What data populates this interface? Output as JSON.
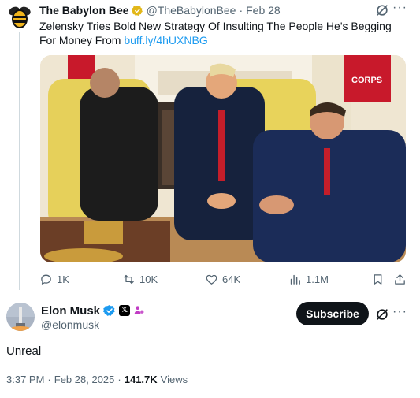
{
  "parent": {
    "author_name": "The Babylon Bee",
    "author_handle": "@TheBabylonBee",
    "separator": "·",
    "date": "Feb 28",
    "text": "Zelensky Tries Bold New Strategy Of Insulting The People He's Begging For Money From",
    "link_text": "buff.ly/4hUXNBG",
    "image_caption": ""
  },
  "actions": {
    "replies": "1K",
    "reposts": "10K",
    "likes": "64K",
    "views": "1.1M"
  },
  "tweet": {
    "author_name": "Elon Musk",
    "author_handle": "@elonmusk",
    "x_badge": "𝕏",
    "subscribe_label": "Subscribe",
    "text": "Unreal",
    "time": "3:37 PM",
    "date_sep": "·",
    "date": "Feb 28, 2025",
    "views_sep": "·",
    "views_count": "141.7K",
    "views_label": "Views"
  },
  "icons": {
    "parent_avatar": "bee-logo-icon",
    "gold_check": "gold-verified-icon",
    "blue_check": "blue-verified-icon",
    "grok": "grok-icon",
    "more": "more-icon",
    "reply": "reply-icon",
    "repost": "repost-icon",
    "like": "heart-icon",
    "views": "analytics-icon",
    "bookmark": "bookmark-icon",
    "share": "share-icon"
  },
  "colors": {
    "accent": "#1d9bf0",
    "gold": "#e2b719",
    "text_muted": "#536471"
  }
}
